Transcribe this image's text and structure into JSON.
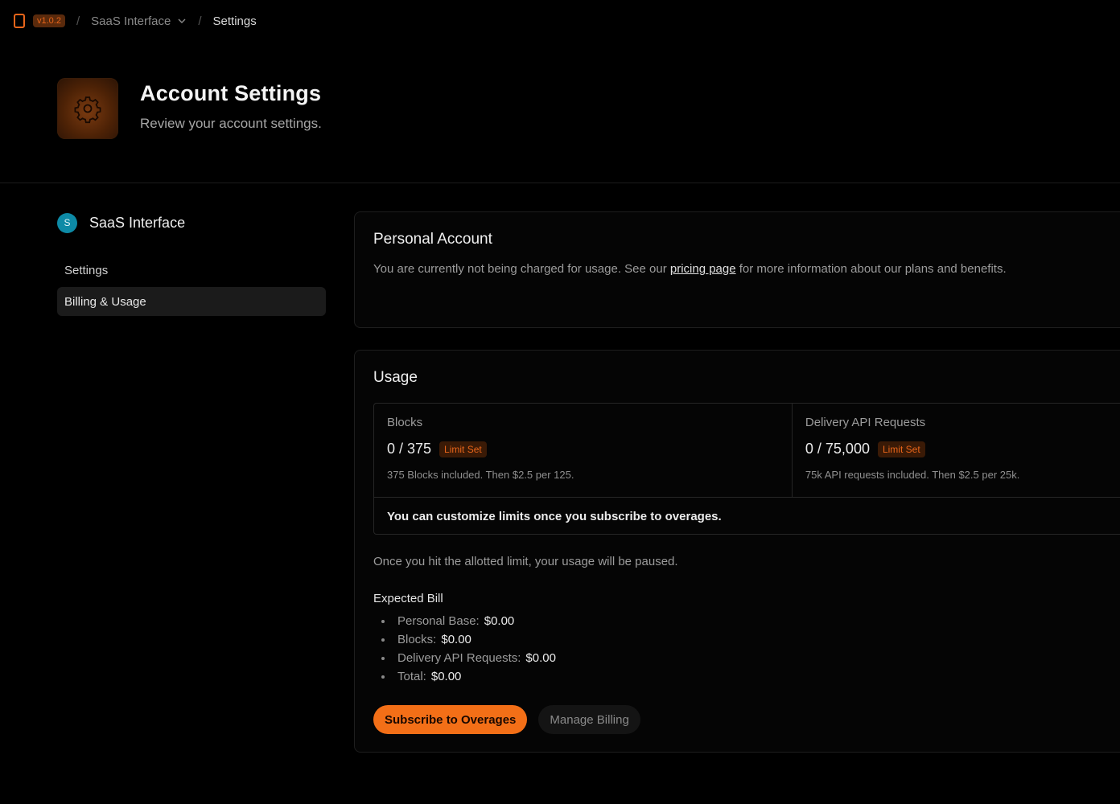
{
  "topbar": {
    "version": "v1.0.2",
    "project": "SaaS Interface",
    "current": "Settings",
    "icons": [
      "app-icon",
      "chevron-down-icon"
    ]
  },
  "header": {
    "title": "Account Settings",
    "subtitle": "Review your account settings.",
    "icon": "gear-icon"
  },
  "sidebar": {
    "workspace_initial": "S",
    "workspace_name": "SaaS Interface",
    "items": [
      {
        "label": "Settings",
        "active": false
      },
      {
        "label": "Billing & Usage",
        "active": true
      }
    ]
  },
  "personal_account": {
    "title": "Personal Account",
    "desc_before": "You are currently not being charged for usage. See our ",
    "link": "pricing page",
    "desc_after": " for more information about our plans and benefits."
  },
  "usage": {
    "title": "Usage",
    "cells": [
      {
        "label": "Blocks",
        "value": "0 / 375",
        "badge": "Limit Set",
        "note": "375 Blocks included. Then $2.5 per 125."
      },
      {
        "label": "Delivery API Requests",
        "value": "0 / 75,000",
        "badge": "Limit Set",
        "note": "75k API requests included. Then $2.5 per 25k."
      }
    ],
    "footer": "You can customize limits once you subscribe to overages.",
    "pause_note": "Once you hit the allotted limit, your usage will be paused.",
    "bill_title": "Expected Bill",
    "bill": [
      {
        "key": "Personal Base:",
        "value": "$0.00"
      },
      {
        "key": "Blocks:",
        "value": "$0.00"
      },
      {
        "key": "Delivery API Requests:",
        "value": "$0.00"
      },
      {
        "key": "Total:",
        "value": "$0.00"
      }
    ],
    "primary_button": "Subscribe to Overages",
    "secondary_button": "Manage Billing"
  },
  "colors": {
    "accent": "#f36f17",
    "background": "#000000",
    "avatar": "#0d8aa6"
  }
}
